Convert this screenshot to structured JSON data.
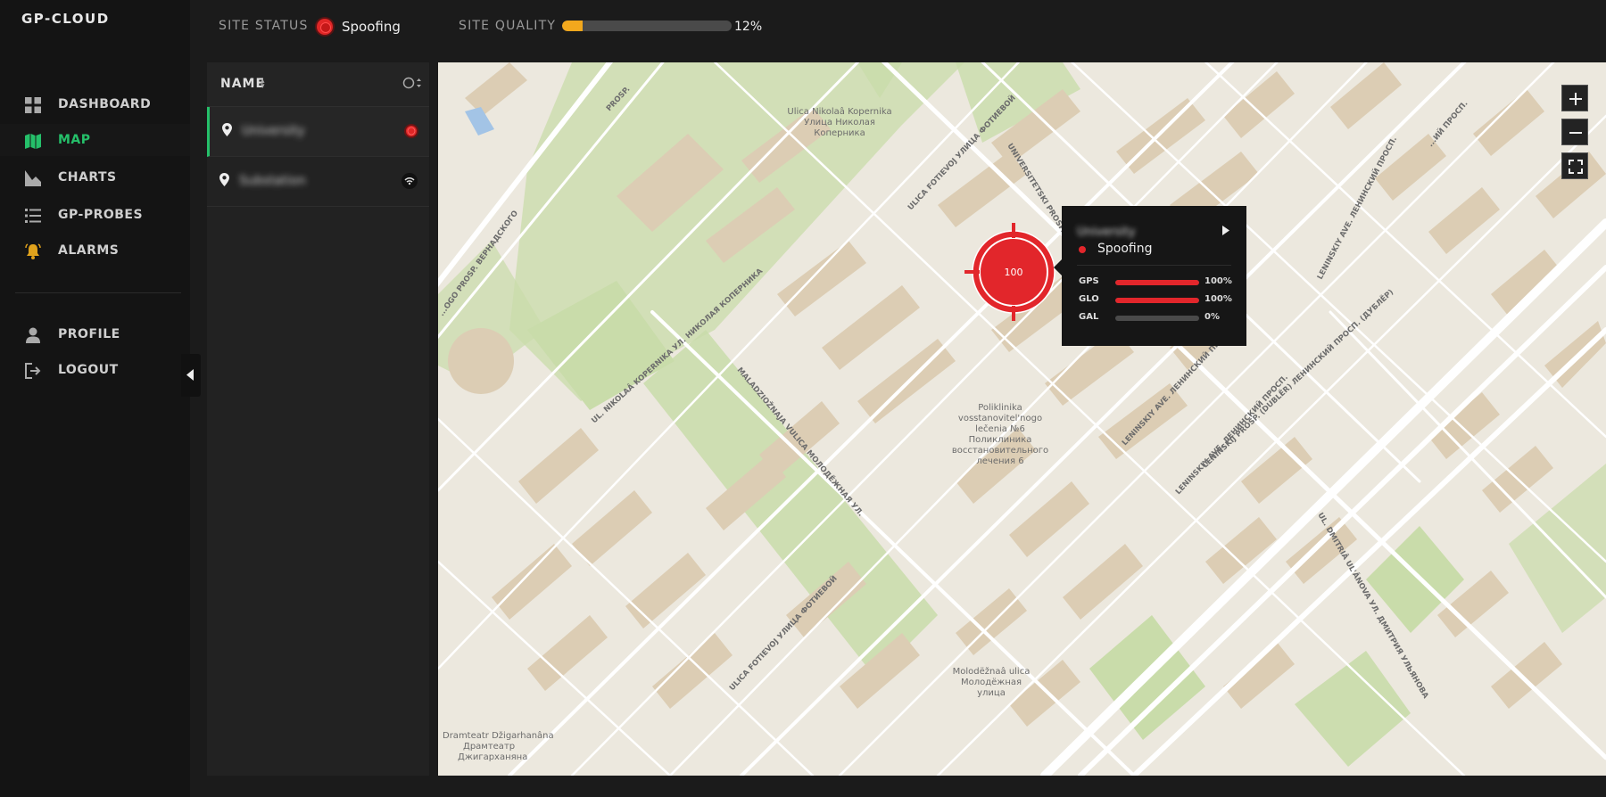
{
  "app": {
    "brand": "GP-CLOUD"
  },
  "nav": {
    "items": [
      {
        "label": "DASHBOARD",
        "icon": "dashboard-grid-icon"
      },
      {
        "label": "MAP",
        "icon": "map-icon",
        "active": true
      },
      {
        "label": "CHARTS",
        "icon": "area-chart-icon"
      },
      {
        "label": "GP-PROBES",
        "icon": "list-icon"
      },
      {
        "label": "ALARMS",
        "icon": "bell-icon"
      }
    ],
    "account": [
      {
        "label": "PROFILE",
        "icon": "user-icon"
      },
      {
        "label": "LOGOUT",
        "icon": "logout-icon"
      }
    ]
  },
  "topbar": {
    "site_status_label": "SITE STATUS",
    "site_status_value": "Spoofing",
    "site_quality_label": "SITE QUALITY",
    "site_quality_value": "12%",
    "site_quality_fraction": 0.12
  },
  "list": {
    "header": "NAME",
    "rows": [
      {
        "name": "University",
        "status": "spoofing",
        "selected": true
      },
      {
        "name": "Substation",
        "status": "signal"
      }
    ]
  },
  "map": {
    "marker_value": "100",
    "labels": {
      "kopernika": [
        "Ulica Nikolaâ Kopernika",
        "Улица Николая",
        "Коперника"
      ],
      "poliklinika": [
        "Poliklinika",
        "vosstanovitel'nogo",
        "lečenia №6",
        "Поликлиника",
        "восстановительного",
        "лечения 6"
      ],
      "molodezhnaya": [
        "Molodëžnaâ ulica",
        "Молодёжная",
        "улица"
      ],
      "dramteatr": [
        "Dramteatr Džigarhanâna",
        "Драмтеатр",
        "Джигарханяна"
      ],
      "street_kopernika": "UL. NIKOLAÂ KOPERNIKA УЛ. НИКОЛАЯ КОПЕРНИКА",
      "street_molodezh": "MALADZIOŽNAJA VULICA МОЛОДЁЖНАЯ УЛ.",
      "street_fotievoj": "ULICA FOTIEVOJ УЛИЦА ФОТИЕВОЙ",
      "street_fotievoj2": "ULICA FOTIEVOJ УЛИЦА ФОТИЕВОЙ",
      "street_vernadskogo": "...OGO PROSP. ВЕРНАДСКОГО",
      "street_universitetski": "UNIVERSITETSKI PROSP.",
      "street_leninskiy1": "LENINSKIY AVE. ЛЕНИНСКИЙ ПРОСП.",
      "street_leninskiy2": "LENINSKIY AVE. ЛЕНИНСКИЙ ПРОСП.",
      "street_leninskiy3": "LENINSKIJ PROSP. (DUBLËR) ЛЕНИНСКИЙ ПРОСП. (ДУБЛЁР)",
      "street_leninskiy4": "LENINSKIY AVE. ЛЕНИНСКИЙ ПРОСП.",
      "street_ulyanova": "UL. DMITRIÂ UL'ÂNOVA УЛ. ДМИТРИЯ УЛЬЯНОВА",
      "street_prosp_top": "PROSP.",
      "street_prosp_top2": "...ИЙ ПРОСП."
    }
  },
  "popup": {
    "name": "University",
    "status": "Spoofing",
    "signals": [
      {
        "label": "GPS",
        "value": "100%",
        "fraction": 1.0
      },
      {
        "label": "GLO",
        "value": "100%",
        "fraction": 1.0
      },
      {
        "label": "GAL",
        "value": "0%",
        "fraction": 0.0
      }
    ]
  },
  "colors": {
    "accent": "#25c06a",
    "alert": "#e2262b",
    "quality": "#f2a81d"
  }
}
